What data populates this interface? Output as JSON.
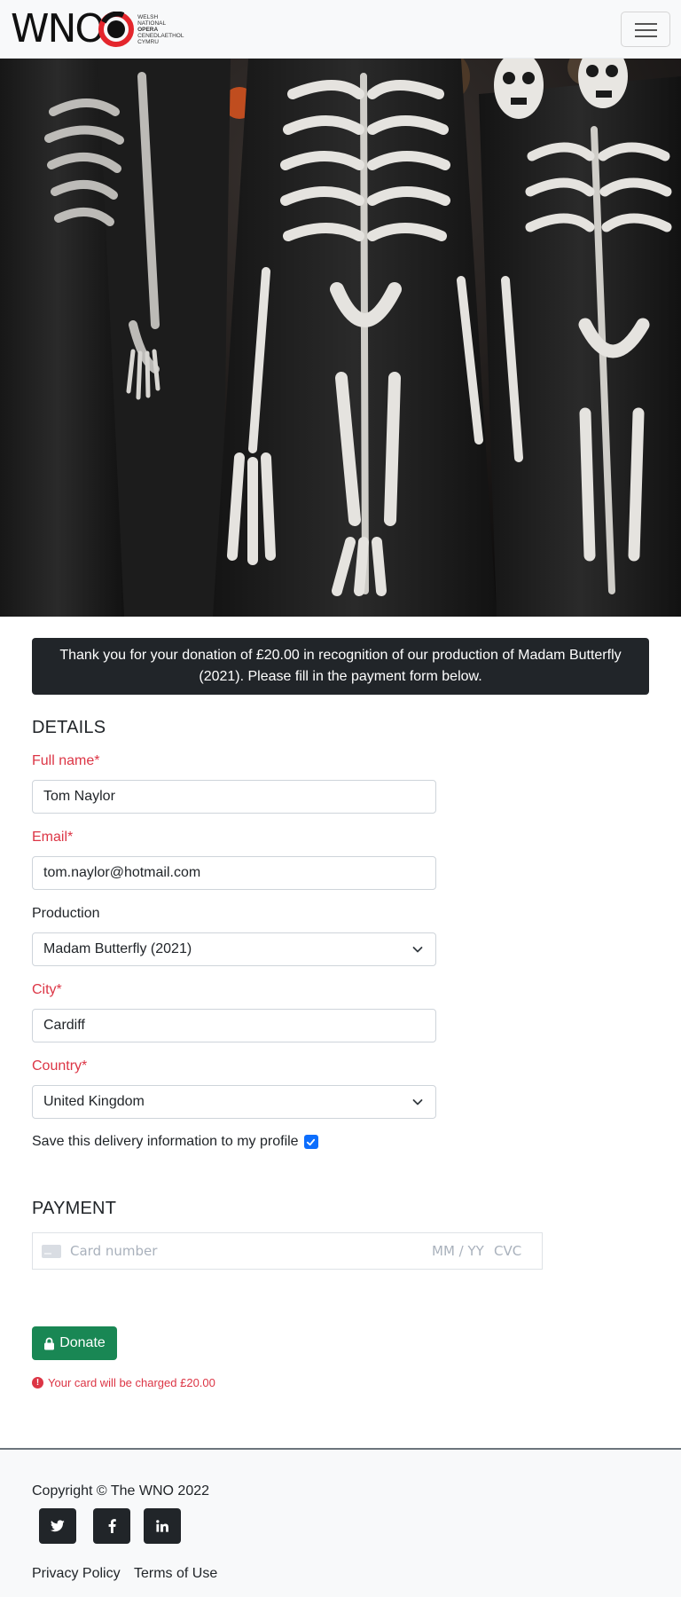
{
  "header": {
    "logo_text": "WNO",
    "logo_sub": [
      "Welsh",
      "National",
      "Opera",
      "Cenedlaethol",
      "Cymru"
    ],
    "menu_icon": "hamburger-icon"
  },
  "hero": {
    "image": "skeleton-costumes-photo"
  },
  "alert": {
    "text": "Thank you for your donation of £20.00 in recognition of our production of Madam Butterfly (2021). Please fill in the payment form below."
  },
  "details": {
    "title": "DETAILS",
    "full_name": {
      "label": "Full name*",
      "value": "Tom Naylor"
    },
    "email": {
      "label": "Email*",
      "value": "tom.naylor@hotmail.com"
    },
    "production": {
      "label": "Production",
      "value": "Madam Butterfly (2021)"
    },
    "city": {
      "label": "City*",
      "value": "Cardiff"
    },
    "country": {
      "label": "Country*",
      "value": "United Kingdom"
    },
    "save_profile": {
      "label": "Save this delivery information to my profile",
      "checked": true
    }
  },
  "payment": {
    "title": "PAYMENT",
    "card_number_placeholder": "Card number",
    "expiry_placeholder": "MM / YY",
    "cvc_placeholder": "CVC",
    "donate_label": "Donate",
    "charge_note": "Your card will be charged £20.00"
  },
  "footer": {
    "copyright": "Copyright © The WNO 2022",
    "social": [
      "twitter-icon",
      "facebook-icon",
      "linkedin-icon"
    ],
    "links": [
      "Privacy Policy",
      "Terms of Use"
    ]
  },
  "colors": {
    "required": "#dc3545",
    "donate": "#198754",
    "alert_bg": "#212529",
    "checkbox": "#0d6efd",
    "logo_red": "#e4262c"
  }
}
